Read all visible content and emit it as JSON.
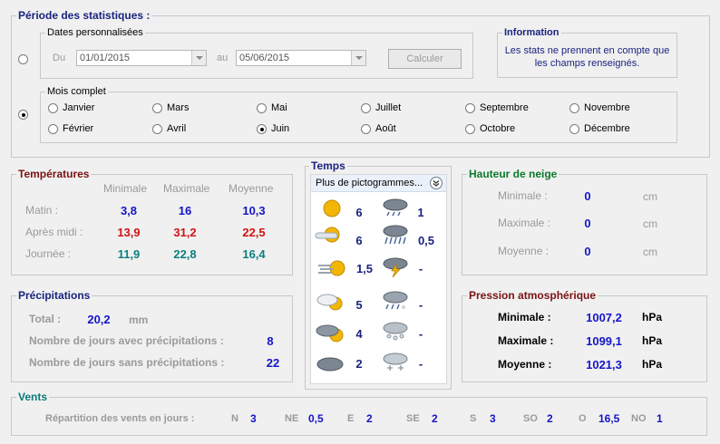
{
  "period": {
    "title": "Période des statistiques :",
    "custom_dates": {
      "legend": "Dates personnalisées",
      "from_label": "Du",
      "from_value": "01/01/2015",
      "to_label": "au",
      "to_value": "05/06/2015",
      "compute_label": "Calculer",
      "selected": false
    },
    "full_month": {
      "legend": "Mois complet",
      "selected": true,
      "months": [
        {
          "label": "Janvier",
          "selected": false
        },
        {
          "label": "Mars",
          "selected": false
        },
        {
          "label": "Mai",
          "selected": false
        },
        {
          "label": "Juillet",
          "selected": false
        },
        {
          "label": "Septembre",
          "selected": false
        },
        {
          "label": "Novembre",
          "selected": false
        },
        {
          "label": "Février",
          "selected": false
        },
        {
          "label": "Avril",
          "selected": false
        },
        {
          "label": "Juin",
          "selected": true
        },
        {
          "label": "Août",
          "selected": false
        },
        {
          "label": "Octobre",
          "selected": false
        },
        {
          "label": "Décembre",
          "selected": false
        }
      ]
    }
  },
  "information": {
    "title": "Information",
    "line1": "Les stats ne prennent en compte que",
    "line2": "les champs renseignés."
  },
  "temperatures": {
    "title": "Températures",
    "columns": [
      "Minimale",
      "Maximale",
      "Moyenne"
    ],
    "rows": [
      {
        "label": "Matin :",
        "values": [
          "3,8",
          "16",
          "10,3"
        ]
      },
      {
        "label": "Après midi :",
        "values": [
          "13,9",
          "31,2",
          "22,5"
        ]
      },
      {
        "label": "Journée :",
        "values": [
          "11,9",
          "22,8",
          "16,4"
        ]
      }
    ]
  },
  "weather": {
    "title": "Temps",
    "dropdown_label": "Plus de pictogrammes...",
    "left": [
      {
        "icon": "sun-icon",
        "count": "6"
      },
      {
        "icon": "sun-cloud-wind-icon",
        "count": "6"
      },
      {
        "icon": "sun-wind-icon",
        "count": "1,5"
      },
      {
        "icon": "cloud-sun-icon",
        "count": "5"
      },
      {
        "icon": "cloud-sun-dark-icon",
        "count": "4"
      },
      {
        "icon": "dark-cloud-icon",
        "count": "2"
      }
    ],
    "right": [
      {
        "icon": "light-rain-icon",
        "count": "1"
      },
      {
        "icon": "rain-icon",
        "count": "0,5"
      },
      {
        "icon": "storm-icon",
        "count": "-"
      },
      {
        "icon": "sleet-icon",
        "count": "-"
      },
      {
        "icon": "hail-icon",
        "count": "-"
      },
      {
        "icon": "snow-icon",
        "count": "-"
      }
    ]
  },
  "snow": {
    "title": "Hauteur de neige",
    "rows": [
      {
        "label": "Minimale :",
        "value": "0",
        "unit": "cm"
      },
      {
        "label": "Maximale :",
        "value": "0",
        "unit": "cm"
      },
      {
        "label": "Moyenne :",
        "value": "0",
        "unit": "cm"
      }
    ]
  },
  "precipitations": {
    "title": "Précipitations",
    "total_label": "Total :",
    "total_value": "20,2",
    "total_unit": "mm",
    "with_label": "Nombre de jours avec précipitations :",
    "with_value": "8",
    "without_label": "Nombre de jours sans précipitations :",
    "without_value": "22"
  },
  "pressure": {
    "title": "Pression atmosphérique",
    "rows": [
      {
        "label": "Minimale :",
        "value": "1007,2",
        "unit": "hPa"
      },
      {
        "label": "Maximale :",
        "value": "1099,1",
        "unit": "hPa"
      },
      {
        "label": "Moyenne :",
        "value": "1021,3",
        "unit": "hPa"
      }
    ]
  },
  "winds": {
    "title": "Vents",
    "label": "Répartition des vents en jours :",
    "items": [
      {
        "dir": "N",
        "value": "3"
      },
      {
        "dir": "NE",
        "value": "0,5"
      },
      {
        "dir": "E",
        "value": "2"
      },
      {
        "dir": "SE",
        "value": "2"
      },
      {
        "dir": "S",
        "value": "3"
      },
      {
        "dir": "SO",
        "value": "2"
      },
      {
        "dir": "O",
        "value": "16,5"
      },
      {
        "dir": "NO",
        "value": "1"
      }
    ]
  },
  "colors": {
    "navy": "#1a237e",
    "maroon": "#7a1212",
    "green": "#0b7a2a",
    "teal": "#0b7a7a",
    "value_blue": "#1515c8",
    "value_red": "#d01414",
    "value_teal": "#0d7f7f"
  }
}
